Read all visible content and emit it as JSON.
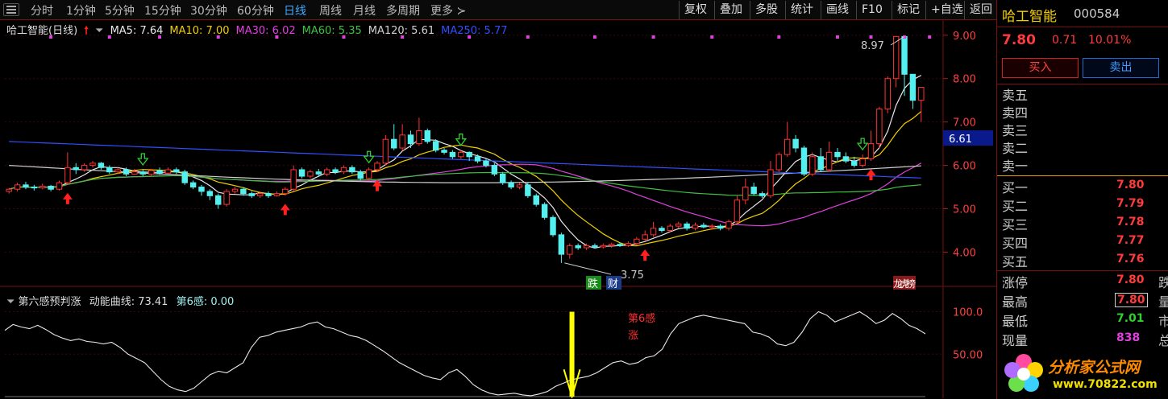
{
  "toolbar": {
    "tabs": [
      "分时",
      "1分钟",
      "5分钟",
      "15分钟",
      "30分钟",
      "60分钟",
      "日线",
      "周线",
      "月线",
      "多周期",
      "更多"
    ],
    "active_tab": "日线",
    "buttons": [
      "复权",
      "叠加",
      "多股",
      "统计",
      "画线",
      "F10",
      "标记",
      "+自选",
      "返回"
    ]
  },
  "legend": {
    "stock": "哈工智能(日线)",
    "ma": [
      {
        "label": "MA5: 7.64",
        "color": "#e8e8e8"
      },
      {
        "label": "MA10: 7.00",
        "color": "#f0d000"
      },
      {
        "label": "MA30: 6.02",
        "color": "#e040e0"
      },
      {
        "label": "MA60: 5.35",
        "color": "#40c040"
      },
      {
        "label": "MA120: 5.61",
        "color": "#d0d0d0"
      },
      {
        "label": "MA250: 5.77",
        "color": "#3050ff"
      }
    ]
  },
  "indicator_legend": {
    "name": "第六感预判涨",
    "curve": "动能曲线: 73.41",
    "sense": "第6感: 0.00"
  },
  "chart_labels": {
    "high_label": "8.97",
    "low_label": "3.75",
    "current_line_price": "6.61",
    "badge_fall": "跌",
    "badge_fin": "财",
    "badge_rank": "龙虎榜",
    "signal_text_1": "第6感",
    "signal_text_2": "涨"
  },
  "chart_data": [
    {
      "type": "candlestick",
      "title": "哈工智能(日线)",
      "y_axis_ticks": [
        "9.00",
        "8.00",
        "7.00",
        "6.00",
        "5.00",
        "4.00"
      ],
      "ylim": [
        3.6,
        9.2
      ],
      "candles": [
        [
          5.4,
          5.45,
          5.35,
          5.48
        ],
        [
          5.45,
          5.55,
          5.4,
          5.6
        ],
        [
          5.55,
          5.5,
          5.45,
          5.62
        ],
        [
          5.5,
          5.48,
          5.42,
          5.55
        ],
        [
          5.48,
          5.52,
          5.45,
          5.58
        ],
        [
          5.52,
          5.45,
          5.4,
          5.55
        ],
        [
          5.45,
          5.6,
          5.42,
          5.65
        ],
        [
          5.6,
          5.95,
          5.55,
          6.3
        ],
        [
          5.95,
          5.9,
          5.8,
          6.05
        ],
        [
          5.9,
          6.0,
          5.85,
          6.05
        ],
        [
          6.0,
          6.05,
          5.95,
          6.1
        ],
        [
          6.05,
          5.95,
          5.9,
          6.08
        ],
        [
          5.95,
          5.85,
          5.8,
          6.0
        ],
        [
          5.85,
          5.9,
          5.8,
          5.95
        ],
        [
          5.9,
          5.8,
          5.75,
          5.95
        ],
        [
          5.8,
          5.85,
          5.78,
          5.92
        ],
        [
          5.85,
          5.8,
          5.75,
          5.9
        ],
        [
          5.8,
          5.88,
          5.75,
          5.92
        ],
        [
          5.88,
          5.82,
          5.78,
          5.95
        ],
        [
          5.82,
          5.9,
          5.8,
          5.95
        ],
        [
          5.9,
          5.85,
          5.8,
          5.95
        ],
        [
          5.85,
          5.6,
          5.55,
          5.9
        ],
        [
          5.6,
          5.5,
          5.45,
          5.65
        ],
        [
          5.5,
          5.4,
          5.3,
          5.55
        ],
        [
          5.4,
          5.3,
          5.2,
          5.45
        ],
        [
          5.3,
          5.1,
          5.0,
          5.35
        ],
        [
          5.1,
          5.4,
          5.05,
          5.45
        ],
        [
          5.4,
          5.45,
          5.35,
          5.5
        ],
        [
          5.45,
          5.35,
          5.3,
          5.5
        ],
        [
          5.35,
          5.3,
          5.25,
          5.4
        ],
        [
          5.3,
          5.35,
          5.25,
          5.4
        ],
        [
          5.35,
          5.3,
          5.25,
          5.4
        ],
        [
          5.3,
          5.35,
          5.28,
          5.4
        ],
        [
          5.35,
          5.45,
          5.3,
          5.5
        ],
        [
          5.45,
          5.9,
          5.4,
          6.0
        ],
        [
          5.9,
          5.75,
          5.7,
          5.95
        ],
        [
          5.75,
          5.85,
          5.7,
          5.9
        ],
        [
          5.85,
          5.8,
          5.75,
          5.92
        ],
        [
          5.8,
          5.9,
          5.75,
          5.95
        ],
        [
          5.9,
          5.85,
          5.8,
          5.95
        ],
        [
          5.85,
          5.95,
          5.8,
          6.0
        ],
        [
          5.95,
          5.85,
          5.8,
          6.0
        ],
        [
          5.85,
          5.7,
          5.65,
          5.9
        ],
        [
          5.7,
          5.9,
          5.65,
          5.95
        ],
        [
          5.9,
          6.05,
          5.85,
          6.1
        ],
        [
          6.05,
          6.6,
          6.0,
          6.7
        ],
        [
          6.6,
          6.4,
          6.35,
          6.95
        ],
        [
          6.4,
          6.7,
          6.35,
          6.95
        ],
        [
          6.7,
          6.5,
          6.4,
          6.8
        ],
        [
          6.5,
          6.8,
          6.45,
          7.1
        ],
        [
          6.8,
          6.55,
          6.5,
          6.85
        ],
        [
          6.55,
          6.35,
          6.3,
          6.6
        ],
        [
          6.35,
          6.3,
          6.25,
          6.4
        ],
        [
          6.3,
          6.2,
          6.15,
          6.35
        ],
        [
          6.2,
          6.3,
          6.15,
          6.35
        ],
        [
          6.3,
          6.2,
          6.1,
          6.32
        ],
        [
          6.2,
          6.1,
          6.05,
          6.25
        ],
        [
          6.1,
          6.0,
          5.95,
          6.15
        ],
        [
          6.0,
          5.8,
          5.75,
          6.05
        ],
        [
          5.8,
          5.6,
          5.55,
          5.85
        ],
        [
          5.6,
          5.5,
          5.45,
          5.65
        ],
        [
          5.5,
          5.55,
          5.45,
          5.6
        ],
        [
          5.55,
          5.3,
          5.25,
          5.6
        ],
        [
          5.3,
          5.1,
          5.05,
          5.35
        ],
        [
          5.1,
          4.8,
          4.75,
          5.15
        ],
        [
          4.8,
          4.4,
          4.35,
          4.85
        ],
        [
          4.4,
          3.95,
          3.75,
          4.45
        ],
        [
          3.95,
          4.15,
          3.85,
          4.2
        ],
        [
          4.15,
          4.1,
          4.05,
          4.2
        ],
        [
          4.1,
          4.15,
          4.05,
          4.2
        ],
        [
          4.15,
          4.12,
          4.08,
          4.2
        ],
        [
          4.12,
          4.15,
          4.08,
          4.2
        ],
        [
          4.15,
          4.18,
          4.1,
          4.22
        ],
        [
          4.18,
          4.15,
          4.12,
          4.22
        ],
        [
          4.15,
          4.2,
          4.12,
          4.25
        ],
        [
          4.2,
          4.3,
          4.15,
          4.35
        ],
        [
          4.3,
          4.4,
          4.25,
          4.5
        ],
        [
          4.4,
          4.55,
          4.35,
          4.7
        ],
        [
          4.55,
          4.5,
          4.45,
          4.6
        ],
        [
          4.5,
          4.6,
          4.45,
          4.65
        ],
        [
          4.6,
          4.65,
          4.55,
          4.7
        ],
        [
          4.65,
          4.55,
          4.5,
          4.7
        ],
        [
          4.55,
          4.62,
          4.5,
          4.68
        ],
        [
          4.62,
          4.58,
          4.55,
          4.68
        ],
        [
          4.58,
          4.6,
          4.52,
          4.65
        ],
        [
          4.6,
          4.55,
          4.5,
          4.65
        ],
        [
          4.55,
          4.7,
          4.5,
          4.75
        ],
        [
          4.7,
          5.2,
          4.65,
          5.3
        ],
        [
          5.2,
          5.5,
          5.1,
          5.7
        ],
        [
          5.5,
          5.35,
          5.3,
          5.6
        ],
        [
          5.35,
          5.3,
          5.25,
          5.4
        ],
        [
          5.3,
          5.9,
          5.25,
          6.1
        ],
        [
          5.9,
          6.25,
          5.85,
          6.3
        ],
        [
          6.25,
          6.6,
          6.2,
          7.0
        ],
        [
          6.6,
          6.4,
          6.3,
          6.7
        ],
        [
          6.4,
          5.8,
          5.75,
          6.45
        ],
        [
          5.8,
          6.2,
          5.75,
          6.3
        ],
        [
          6.2,
          5.9,
          5.85,
          6.4
        ],
        [
          5.9,
          6.3,
          5.85,
          6.55
        ],
        [
          6.3,
          6.2,
          6.1,
          6.4
        ],
        [
          6.2,
          6.1,
          6.05,
          6.3
        ],
        [
          6.1,
          6.0,
          5.95,
          6.2
        ],
        [
          6.0,
          6.15,
          5.95,
          6.25
        ],
        [
          6.15,
          6.5,
          6.1,
          6.8
        ],
        [
          6.5,
          7.3,
          6.4,
          7.35
        ],
        [
          7.3,
          8.0,
          7.2,
          8.05
        ],
        [
          8.0,
          8.97,
          7.8,
          8.97
        ],
        [
          8.97,
          8.1,
          7.6,
          8.97
        ],
        [
          8.1,
          7.5,
          7.3,
          8.1
        ],
        [
          7.5,
          7.8,
          7.0,
          7.8
        ]
      ],
      "series": [
        {
          "name": "MA5",
          "color": "#e8e8e8"
        },
        {
          "name": "MA10",
          "color": "#f0d000"
        },
        {
          "name": "MA30",
          "color": "#e040e0"
        },
        {
          "name": "MA60",
          "color": "#40c040"
        },
        {
          "name": "MA120",
          "color": "#d0d0d0"
        },
        {
          "name": "MA250",
          "color": "#3050ff"
        }
      ],
      "up_arrow_indices": [
        7,
        33,
        44,
        76,
        103
      ],
      "down_arrow_indices": [
        16,
        43,
        54,
        102
      ],
      "dotted_indices": [
        5,
        12,
        18,
        25,
        32,
        40,
        47,
        55,
        62,
        70,
        77,
        84,
        92,
        99,
        103,
        107,
        110
      ]
    },
    {
      "type": "line",
      "title": "第六感预判涨",
      "y_axis_ticks": [
        "100.0",
        "50.00"
      ],
      "ylim": [
        0,
        110
      ],
      "series": [
        {
          "name": "动能曲线",
          "values": [
            78,
            85,
            82,
            80,
            84,
            79,
            73,
            69,
            66,
            68,
            65,
            64,
            62,
            64,
            58,
            50,
            45,
            40,
            30,
            20,
            12,
            8,
            6,
            10,
            18,
            26,
            30,
            28,
            34,
            40,
            58,
            70,
            72,
            76,
            78,
            80,
            82,
            86,
            88,
            82,
            80,
            76,
            72,
            70,
            66,
            60,
            54,
            47,
            40,
            35,
            30,
            25,
            22,
            20,
            28,
            32,
            24,
            14,
            8,
            4,
            2,
            3,
            4,
            2,
            1,
            3,
            6,
            12,
            16,
            20,
            22,
            24,
            28,
            34,
            40,
            42,
            38,
            40,
            46,
            48,
            56,
            74,
            86,
            90,
            94,
            96,
            94,
            92,
            90,
            88,
            86,
            76,
            74,
            70,
            62,
            60,
            64,
            76,
            92,
            100,
            96,
            88,
            92,
            96,
            100,
            94,
            86,
            90,
            98,
            92,
            84,
            80,
            74
          ]
        }
      ],
      "signal_index": 69
    }
  ],
  "panel": {
    "name": "哈工智能",
    "code": "000584",
    "price": "7.80",
    "change": "0.71",
    "change_pct": "10.01%",
    "buy_button": "买入",
    "sell_button": "卖出",
    "asks": [
      "卖五",
      "卖四",
      "卖三",
      "卖二",
      "卖一"
    ],
    "bids": [
      {
        "label": "买一",
        "value": "7.80"
      },
      {
        "label": "买二",
        "value": "7.79"
      },
      {
        "label": "买三",
        "value": "7.78"
      },
      {
        "label": "买四",
        "value": "7.77"
      },
      {
        "label": "买五",
        "value": "7.76"
      }
    ],
    "stats": [
      {
        "label": "涨停",
        "value": "7.80",
        "color": "#ff3b3b",
        "extra": "跌"
      },
      {
        "label": "最高",
        "value": "7.80",
        "color": "#ff3b3b",
        "extra": "量"
      },
      {
        "label": "最低",
        "value": "7.01",
        "color": "#30d030",
        "extra": "市"
      },
      {
        "label": "现量",
        "value": "838",
        "color": "#e040e0",
        "extra": "总"
      }
    ]
  },
  "watermark": {
    "text": "分析家公式网",
    "url": "www.70822.com"
  }
}
